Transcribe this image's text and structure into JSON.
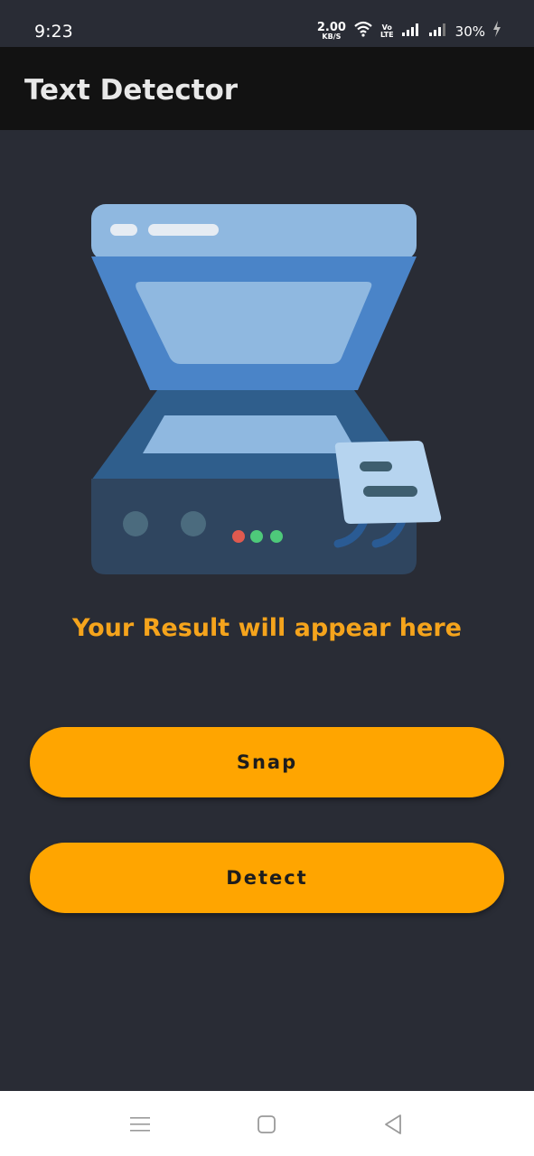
{
  "status_bar": {
    "time": "9:23",
    "net_speed_value": "2.00",
    "net_speed_unit": "KB/S",
    "volte_top": "Vo",
    "volte_bottom": "LTE",
    "battery": "30%"
  },
  "app_bar": {
    "title": "Text Detector"
  },
  "main": {
    "result_placeholder": "Your Result will appear here",
    "snap_label": "Snap",
    "detect_label": "Detect"
  },
  "colors": {
    "background": "#292c35",
    "app_bar": "#121212",
    "accent": "#ffa500",
    "result_text": "#f5a41c"
  },
  "icons": {
    "wifi": "wifi-icon",
    "signal": "signal-icon",
    "battery": "charging-icon",
    "nav_menu": "menu-icon",
    "nav_home": "home-icon",
    "nav_back": "back-icon",
    "illustration": "scanner-illustration"
  }
}
